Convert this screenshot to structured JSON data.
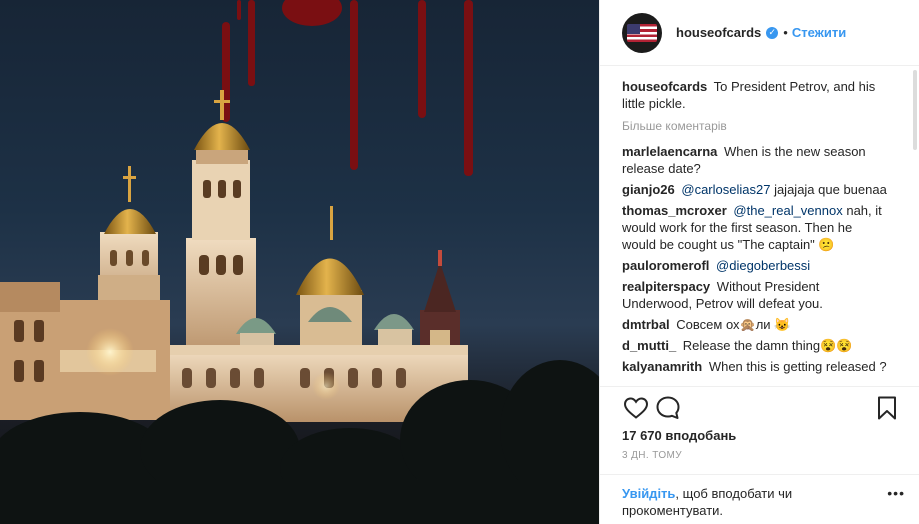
{
  "header": {
    "username": "houseofcards",
    "separator": "•",
    "follow_label": "Стежити",
    "verified_icon": "verified-badge-icon"
  },
  "caption": {
    "username": "houseofcards",
    "text": "To President Petrov, and his little pickle."
  },
  "more_comments_label": "Більше коментарів",
  "comments": [
    {
      "user": "marlelaencarna",
      "text": "When is the new season release date?"
    },
    {
      "user": "gianjo26",
      "mention": "@carloselias27",
      "text": " jajajaja que buenaa"
    },
    {
      "user": "thomas_mcroxer",
      "mention": "@the_real_vennox",
      "text": " nah, it would work for the first season. Then he would be cought us \"The captain\" 😕"
    },
    {
      "user": "pauloromerofl",
      "mention": "@diegoberbessi",
      "text": ""
    },
    {
      "user": "realpiterspacy",
      "text": "Without President Underwood, Petrov will defeat you."
    },
    {
      "user": "dmtrbal",
      "text": "Совсем ох🙊ли 😺"
    },
    {
      "user": "d_mutti_",
      "text": "Release the damn thing😵😵"
    },
    {
      "user": "kalyanamrith",
      "text": "When this is getting released ?"
    }
  ],
  "actions": {
    "like_icon": "heart-icon",
    "comment_icon": "comment-bubble-icon",
    "save_icon": "bookmark-icon"
  },
  "likes": "17 670 вподобань",
  "posted_time": "3 ДН. ТОМУ",
  "footer": {
    "login_label": "Увійдіть",
    "rest": ", щоб вподобати чи прокоментувати.",
    "options_label": "•••"
  },
  "colors": {
    "accent": "#3897f0",
    "text": "#262626",
    "muted": "#999999",
    "mention": "#003569"
  }
}
